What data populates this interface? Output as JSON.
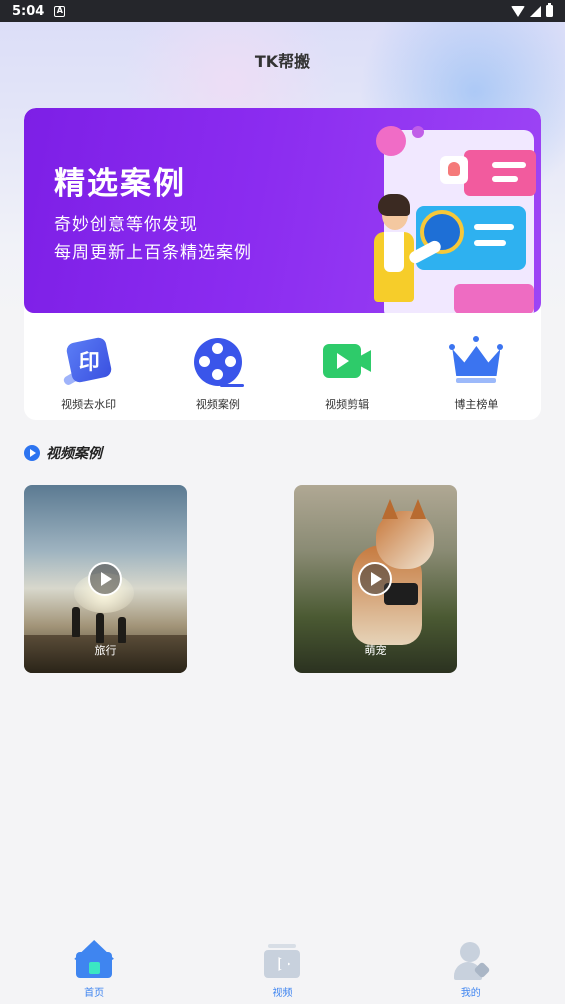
{
  "status_bar": {
    "time": "5:04",
    "notification_icon": "A"
  },
  "header": {
    "title": "TK帮搬"
  },
  "banner": {
    "title": "精选案例",
    "line1": "奇妙创意等你发现",
    "line2": "每周更新上百条精选案例"
  },
  "features": [
    {
      "label": "视频去水印",
      "icon": "watermark-icon",
      "glyph": "印"
    },
    {
      "label": "视频案例",
      "icon": "film-reel-icon"
    },
    {
      "label": "视频剪辑",
      "icon": "video-camera-icon"
    },
    {
      "label": "博主榜单",
      "icon": "crown-icon"
    }
  ],
  "section": {
    "title": "视频案例"
  },
  "videos": [
    {
      "caption": "旅行"
    },
    {
      "caption": "萌宠"
    }
  ],
  "bottom_nav": [
    {
      "label": "首页",
      "active": true,
      "color": "#3f85f0"
    },
    {
      "label": "视频",
      "active": false,
      "color": "#3f85f0"
    },
    {
      "label": "我的",
      "active": false,
      "color": "#3f85f0"
    }
  ],
  "colors": {
    "accent": "#3f85f0",
    "banner_purple": "#8b2cf0"
  }
}
